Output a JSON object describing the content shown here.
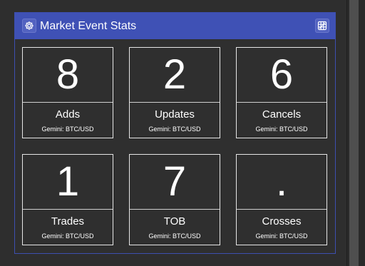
{
  "panel": {
    "title": "Market Event Stats",
    "settings_icon": "gear-icon",
    "view_icon": "grid-icon"
  },
  "stats": [
    {
      "value": "8",
      "label": "Adds",
      "source": "Gemini: BTC/USD"
    },
    {
      "value": "2",
      "label": "Updates",
      "source": "Gemini: BTC/USD"
    },
    {
      "value": "6",
      "label": "Cancels",
      "source": "Gemini: BTC/USD"
    },
    {
      "value": "1",
      "label": "Trades",
      "source": "Gemini: BTC/USD"
    },
    {
      "value": "7",
      "label": "TOB",
      "source": "Gemini: BTC/USD"
    },
    {
      "value": ".",
      "label": "Crosses",
      "source": "Gemini: BTC/USD"
    }
  ],
  "colors": {
    "header": "#3f51b5",
    "background": "#2e2e2e",
    "card_border": "#e6e6e6",
    "text": "#ffffff"
  }
}
